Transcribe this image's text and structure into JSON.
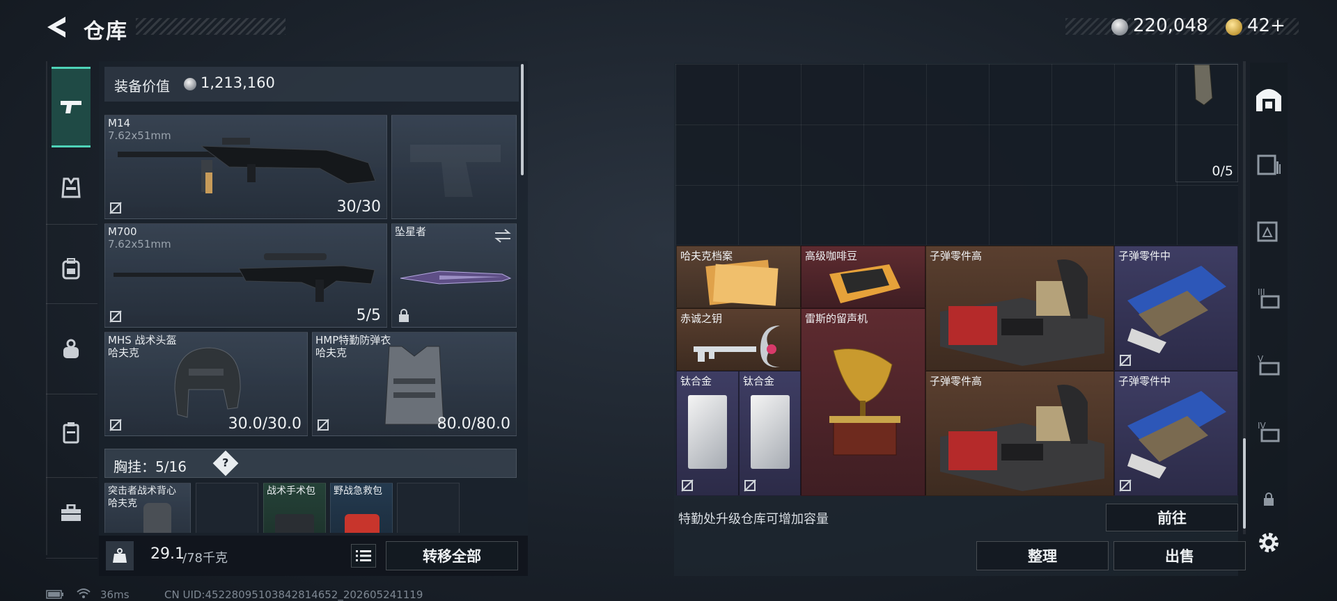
{
  "header": {
    "title": "仓库"
  },
  "currency": {
    "silver": "220,048",
    "gold": "42+"
  },
  "equipment": {
    "value_label": "装备价值",
    "value": "1,213,160",
    "weapons": [
      {
        "name": "M14",
        "caliber": "7.62x51mm",
        "ammo": "30/30"
      },
      {
        "name": "M700",
        "caliber": "7.62x51mm",
        "ammo": "5/5"
      }
    ],
    "melee": {
      "name": "坠星者"
    },
    "helmet": {
      "name": "MHS 战术头盔",
      "brand": "哈夫克",
      "durability": "30.0/30.0"
    },
    "armor": {
      "name": "HMP特勤防弹衣",
      "brand": "哈夫克",
      "durability": "80.0/80.0"
    },
    "chest": {
      "label": "胸挂：",
      "count": "5/16",
      "help": "?"
    },
    "chest_items": [
      {
        "name": "突击者战术背心",
        "brand": "哈夫克"
      },
      {
        "name": ""
      },
      {
        "name": "战术手术包"
      },
      {
        "name": "野战急救包"
      },
      {
        "name": ""
      }
    ],
    "weight": {
      "value": "29.1",
      "max": "/78千克"
    },
    "transfer_all": "转移全部"
  },
  "storage": {
    "slot_counter": "0/5",
    "items": [
      {
        "label": "哈夫克档案",
        "color": "orange"
      },
      {
        "label": "高级咖啡豆",
        "color": "red"
      },
      {
        "label": "子弹零件高",
        "color": "brown"
      },
      {
        "label": "子弹零件中",
        "color": "purple"
      },
      {
        "label": "赤诚之钥",
        "color": "brown"
      },
      {
        "label": "雷斯的留声机",
        "color": "red"
      },
      {
        "label": "钛合金",
        "color": "purple"
      },
      {
        "label": "钛合金",
        "color": "purple"
      },
      {
        "label": "子弹零件高",
        "color": "brown"
      },
      {
        "label": "子弹零件中",
        "color": "purple"
      }
    ],
    "upgrade_hint": "特勤处升级仓库可增加容量",
    "goto_button": "前往",
    "sort_button": "整理",
    "sell_button": "出售"
  },
  "status": {
    "ping": "36ms",
    "uid": "CN UID:4522809510384281465​2_202605241119"
  },
  "icons": {
    "back": "back-arrow-icon",
    "sidebar": [
      "gun-icon",
      "vest-icon",
      "backpack-icon",
      "pouch-icon",
      "case-icon",
      "toolbox-icon"
    ],
    "right": [
      "home-storage-icon",
      "storage-1-icon",
      "storage-2-icon",
      "storage-3-icon",
      "storage-4-icon",
      "storage-5-icon",
      "lock-icon",
      "settings-gear-icon"
    ]
  }
}
